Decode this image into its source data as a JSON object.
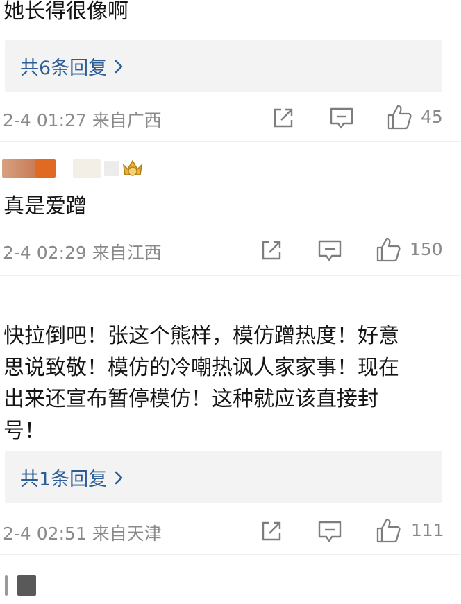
{
  "comments": [
    {
      "text": "她长得很像啊",
      "reply_label": "共6条回复",
      "meta": "2-4 01:27 来自广西",
      "likes": "45"
    },
    {
      "text": "真是爱蹭",
      "meta": "2-4 02:29 来自江西",
      "likes": "150"
    },
    {
      "text": "快拉倒吧！张这个熊样，模仿蹭热度！好意思说致敬！模仿的冷嘲热讽人家家事！现在出来还宣布暂停模仿！这种就应该直接封号！",
      "lines": [
        "快拉倒吧！张这个熊样，模仿蹭热度！好意",
        "思说致敬！模仿的冷嘲热讽人家家事！现在",
        "出来还宣布暂停模仿！这种就应该直接封",
        "号！"
      ],
      "reply_label": "共1条回复",
      "meta": "2-4 02:51 来自天津",
      "likes": "111"
    }
  ],
  "icons": {
    "share": "share-icon",
    "comment": "comment-icon",
    "like": "thumbs-up-icon",
    "reply_chevron": "chevron-right-icon",
    "badge": "crown-badge-icon"
  },
  "colors": {
    "link": "#2c5d94",
    "meta": "#8a8a8a",
    "reply_bg": "#f3f3f3"
  }
}
